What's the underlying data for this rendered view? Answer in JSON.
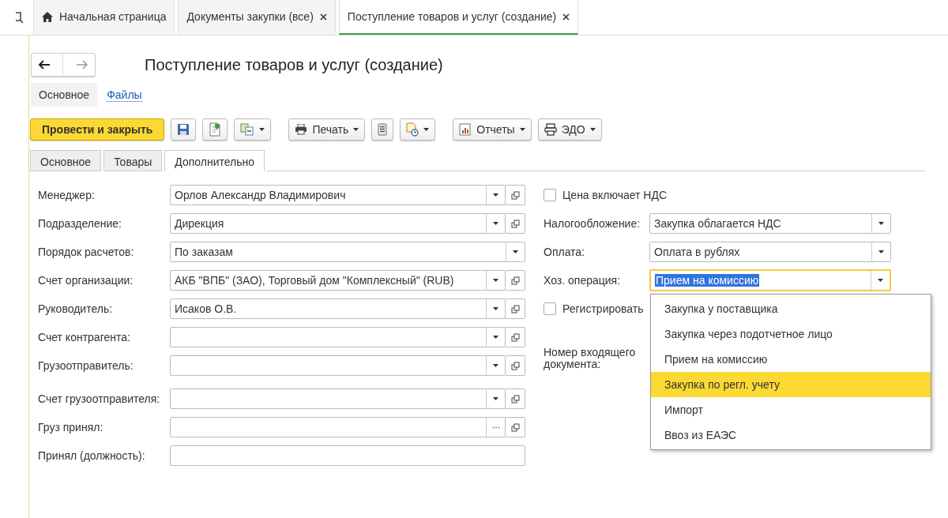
{
  "tabs": [
    {
      "label": "Начальная страница",
      "kind": "home",
      "selected": false,
      "closable": false
    },
    {
      "label": "Документы закупки (все)",
      "kind": "doc",
      "selected": false,
      "closable": true
    },
    {
      "label": "Поступление товаров и услуг (создание)",
      "kind": "doc",
      "selected": true,
      "closable": true
    }
  ],
  "form": {
    "title": "Поступление товаров и услуг (создание)",
    "sections": [
      {
        "label": "Основное",
        "selected": true
      },
      {
        "label": "Файлы",
        "selected": false
      }
    ],
    "toolbar": [
      {
        "kind": "primary",
        "label": "Провести и закрыть",
        "dropdown": false
      },
      {
        "kind": "icon",
        "dropdown": false
      },
      {
        "kind": "icon",
        "dropdown": false
      },
      {
        "kind": "icon",
        "dropdown": true
      },
      {
        "kind": "icon",
        "label": "Печать",
        "dropdown": true
      },
      {
        "kind": "icon",
        "dropdown": false
      },
      {
        "kind": "icon",
        "dropdown": true
      },
      {
        "kind": "icon",
        "label": "Отчеты",
        "dropdown": true
      },
      {
        "kind": "icon",
        "label": "ЭДО",
        "dropdown": true
      }
    ],
    "page_tabs": [
      {
        "label": "Основное",
        "selected": false
      },
      {
        "label": "Товары",
        "selected": false
      },
      {
        "label": "Дополнительно",
        "selected": true
      }
    ],
    "left_fields": [
      {
        "label": "Менеджер:",
        "value": "Орлов Александр Владимирович",
        "dropdown": true,
        "choice": false,
        "open": true
      },
      {
        "label": "Подразделение:",
        "value": "Дирекция",
        "dropdown": true,
        "choice": false,
        "open": true
      },
      {
        "label": "Порядок расчетов:",
        "value": "По заказам",
        "dropdown": true,
        "choice": false,
        "open": false
      },
      {
        "label": "Счет организации:",
        "value": "АКБ \"ВПБ\" (ЗАО), Торговый дом \"Комплексный\" (RUB)",
        "dropdown": true,
        "choice": false,
        "open": true
      },
      {
        "label": "Руководитель:",
        "value": "Исаков О.В.",
        "dropdown": true,
        "choice": false,
        "open": true
      },
      {
        "label": "Счет контрагента:",
        "dropdown": true,
        "choice": false,
        "open": true
      },
      {
        "label": "Грузоотправитель:",
        "dropdown": true,
        "choice": false,
        "open": true
      },
      {
        "label": "Счет грузоотправителя:",
        "dropdown": true,
        "choice": false,
        "open": true
      },
      {
        "label": "Груз принял:",
        "dropdown": false,
        "choice": true,
        "open": true
      },
      {
        "label": "Принял (должность):",
        "dropdown": false,
        "choice": false,
        "open": false
      }
    ],
    "right_fields": [
      {
        "kind": "checkbox",
        "label": "Цена включает НДС",
        "checked": false
      },
      {
        "kind": "select",
        "label": "Налогообложение:",
        "value": "Закупка облагается НДС",
        "focused": false
      },
      {
        "kind": "select",
        "label": "Оплата:",
        "value": "Оплата в рублях",
        "focused": false
      },
      {
        "kind": "select",
        "label": "Хоз. операция:",
        "value": "Прием на комиссию",
        "focused": true,
        "dropdown": [
          {
            "label": "Закупка у поставщика",
            "highlighted": false
          },
          {
            "label": "Закупка через подотчетное лицо",
            "highlighted": false
          },
          {
            "label": "Прием на комиссию",
            "highlighted": false
          },
          {
            "label": "Закупка по регл. учету",
            "highlighted": true
          },
          {
            "label": "Импорт",
            "highlighted": false
          },
          {
            "label": "Ввоз из ЕАЭС",
            "highlighted": false
          }
        ]
      },
      {
        "kind": "checkbox",
        "label": "Регистрировать",
        "checked": false
      },
      {
        "kind": "label",
        "label": "Номер входящего документа:"
      }
    ]
  }
}
